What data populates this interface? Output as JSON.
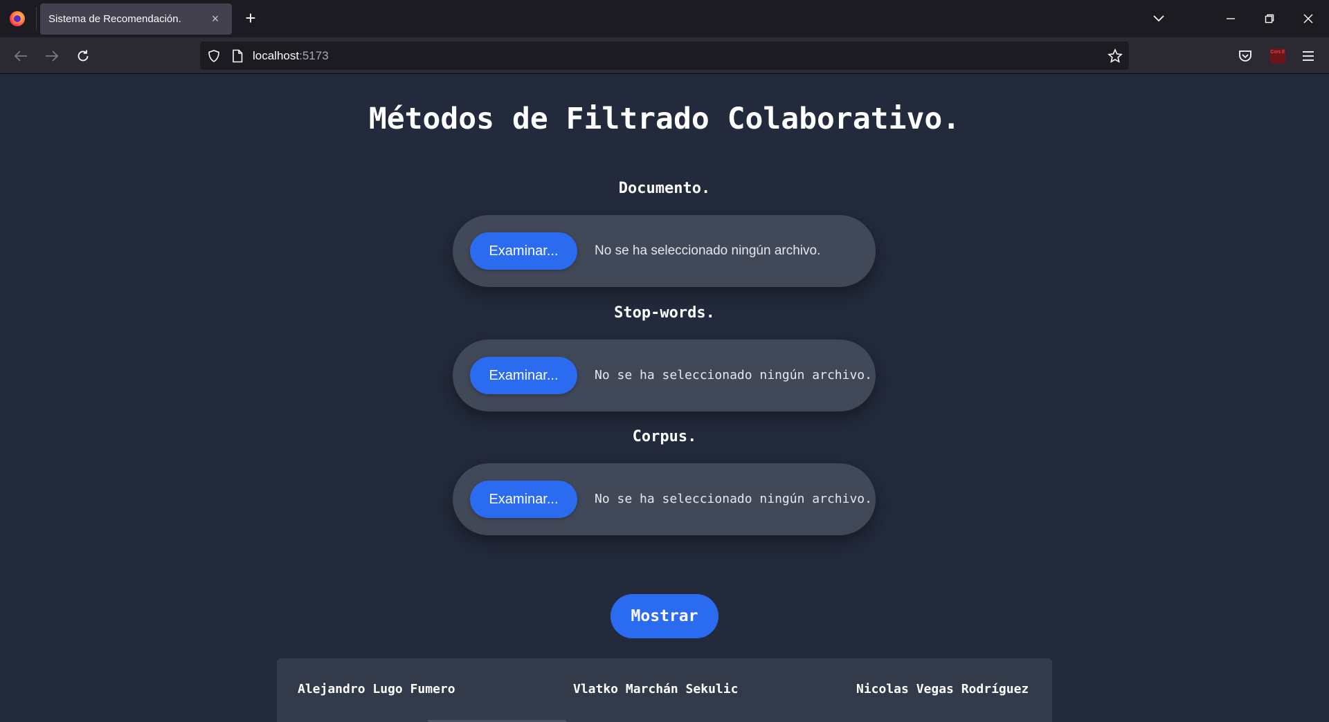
{
  "browser": {
    "tab_title": "Sistema de Recomendación.",
    "tab_close": "×",
    "new_tab": "+",
    "url_host": "localhost",
    "url_port": ":5173",
    "extension_label": "Cors E"
  },
  "page": {
    "title": "Métodos de Filtrado Colaborativo.",
    "sections": [
      {
        "label": "Documento.",
        "button": "Examinar...",
        "status": "No se ha seleccionado ningún archivo."
      },
      {
        "label": "Stop-words.",
        "button": "Examinar...",
        "status": "No se ha seleccionado ningún archivo."
      },
      {
        "label": "Corpus.",
        "button": "Examinar...",
        "status": "No se ha seleccionado ningún archivo."
      }
    ],
    "show_button": "Mostrar",
    "authors": [
      "Alejandro Lugo Fumero",
      "Vlatko Marchán Sekulic",
      "Nicolas Vegas Rodríguez"
    ]
  },
  "colors": {
    "page_bg": "#222a3b",
    "pill_bg": "#414858",
    "accent": "#2b6bf0",
    "footer_bg": "#333b4b"
  }
}
